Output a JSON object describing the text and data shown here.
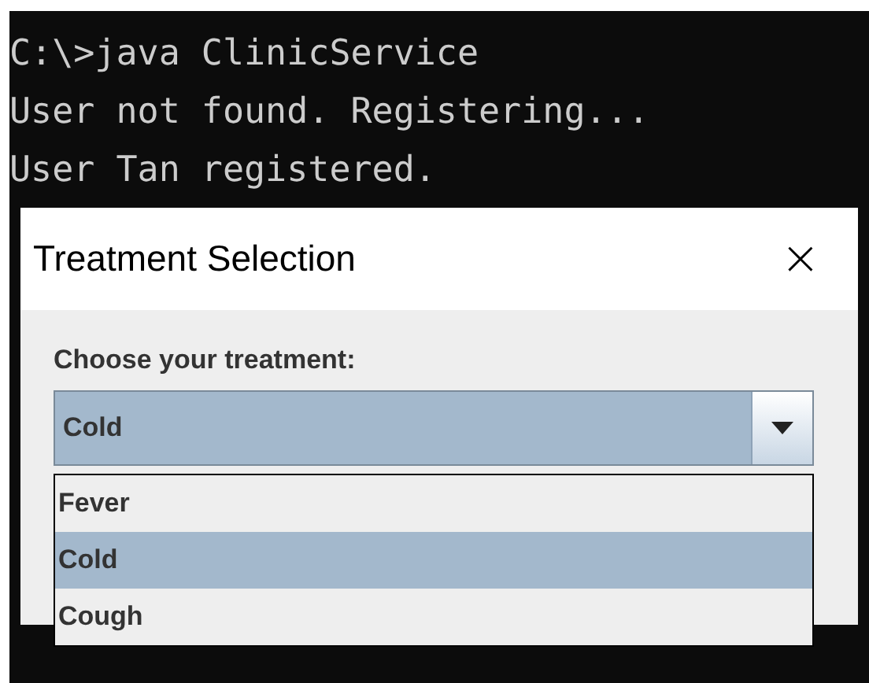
{
  "console": {
    "lines": [
      "C:\\>java ClinicService",
      "User not found. Registering...",
      "User Tan registered."
    ]
  },
  "dialog": {
    "title": "Treatment Selection",
    "close": "×",
    "label": "Choose your treatment:",
    "combo": {
      "value": "Cold",
      "expanded": true,
      "options": [
        {
          "label": "Fever",
          "selected": false
        },
        {
          "label": "Cold",
          "selected": true
        },
        {
          "label": "Cough",
          "selected": false
        }
      ]
    }
  }
}
